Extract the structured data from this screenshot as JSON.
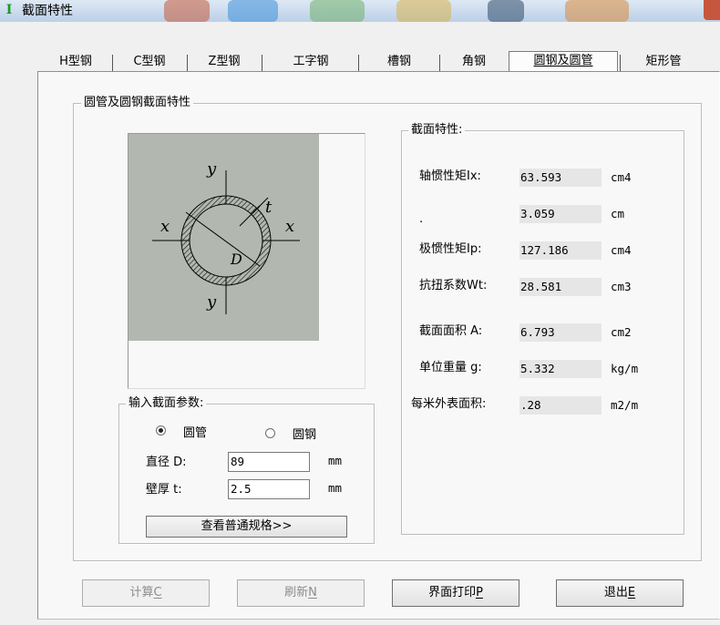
{
  "window": {
    "title": "截面特性"
  },
  "tabs": [
    {
      "label": "H型钢"
    },
    {
      "label": "C型钢"
    },
    {
      "label": "Z型钢"
    },
    {
      "label": "工字钢"
    },
    {
      "label": "槽钢"
    },
    {
      "label": "角钢"
    },
    {
      "label": "圆钢及圆管"
    },
    {
      "label": "矩形管"
    }
  ],
  "active_tab": "圆钢及圆管",
  "section_group": {
    "title": "圆管及圆钢截面特性"
  },
  "diagram": {
    "y_label": "y",
    "x_label": "x",
    "t_label": "t",
    "d_label": "D",
    "background": "#b2b8b0"
  },
  "input_group": {
    "title": "输入截面参数:",
    "radio_tube": "圆管",
    "radio_bar": "圆钢",
    "selected": "圆管",
    "diameter_label": "直径 D:",
    "diameter_value": "89",
    "diameter_unit": "mm",
    "thickness_label": "壁厚 t:",
    "thickness_value": "2.5",
    "thickness_unit": "mm",
    "spec_button": "查看普通规格>>"
  },
  "props_group": {
    "title": "截面特性:",
    "rows": [
      {
        "label": "轴惯性矩Ix:",
        "value": "63.593",
        "unit": "cm4"
      },
      {
        "label": ".",
        "value": "3.059",
        "unit": "cm"
      },
      {
        "label": "极惯性矩Ip:",
        "value": "127.186",
        "unit": "cm4"
      },
      {
        "label": "抗扭系数Wt:",
        "value": "28.581",
        "unit": "cm3"
      },
      {
        "label": "截面面积 A:",
        "value": "6.793",
        "unit": "cm2"
      },
      {
        "label": "单位重量 g:",
        "value": "5.332",
        "unit": "kg/m"
      },
      {
        "label": "每米外表面积:",
        "value": ".28",
        "unit": "m2/m"
      }
    ]
  },
  "buttons": {
    "calc": {
      "label": "计算",
      "hotkey": "C"
    },
    "refresh": {
      "label": "刷新",
      "hotkey": "N"
    },
    "print": {
      "label": "界面打印",
      "hotkey": "P"
    },
    "exit": {
      "label": "退出",
      "hotkey": "E"
    }
  }
}
